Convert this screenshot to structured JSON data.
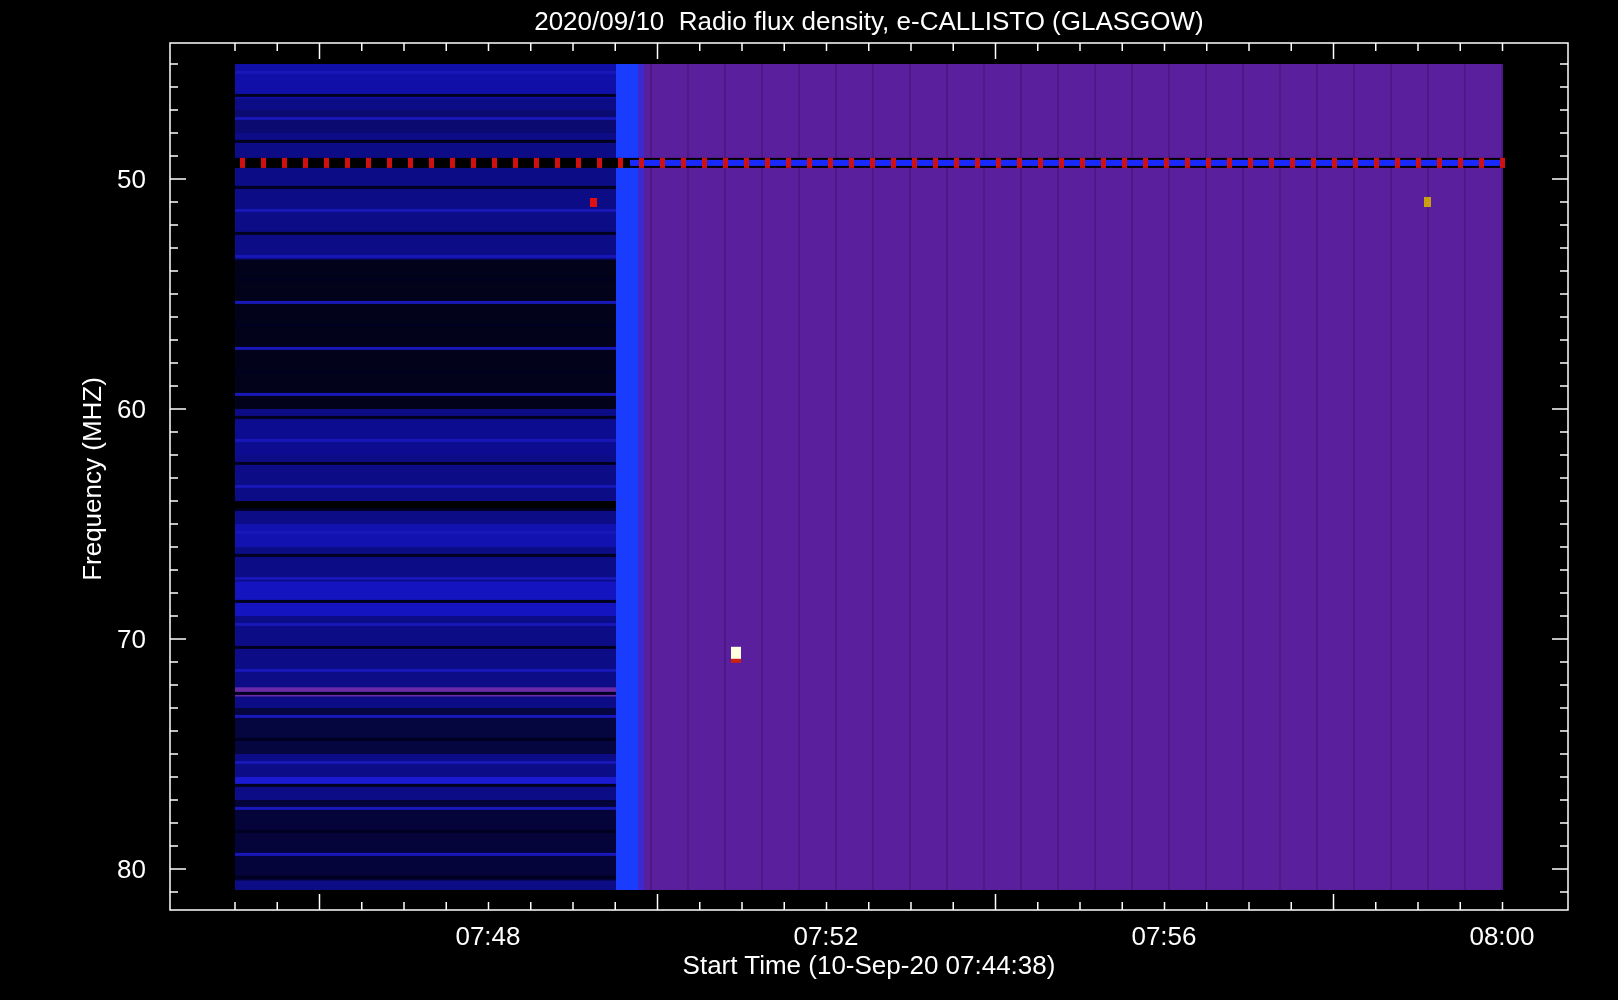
{
  "title": "2020/09/10  Radio flux density, e-CALLISTO (GLASGOW)",
  "y_axis": {
    "label": "Frequency (MHZ)",
    "ticks": [
      "50",
      "60",
      "70",
      "80"
    ]
  },
  "x_axis": {
    "label": "Start Time (10-Sep-20 07:44:38)",
    "ticks": [
      "07:48",
      "07:52",
      "07:56",
      "08:00"
    ]
  }
}
